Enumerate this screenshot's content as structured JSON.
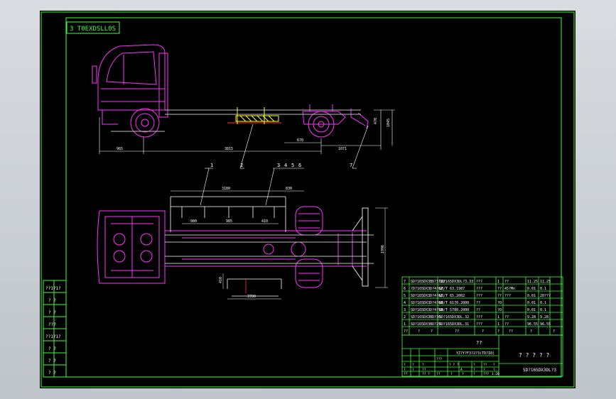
{
  "drawing": {
    "code_box": "3 T0EXDSLL0S",
    "title_main": "? ? ? ? ?",
    "drawing_no": "SD?165DX3DL?3",
    "company": "?? ",
    "sub_code": "YZ?Y?F3?2?3(TD?I0)"
  },
  "callouts": {
    "side": [
      "1",
      "2",
      "7"
    ],
    "plan": [
      "1",
      "3",
      "4",
      "5",
      "6"
    ]
  },
  "dims": {
    "side_front": "965",
    "side_wheelbase": "3815",
    "side_rear1": "670",
    "side_rear2": "1071",
    "side_h1": "470",
    "side_h2": "1045",
    "plan_top": "3180",
    "plan_top2": "830",
    "plan_a": "980",
    "plan_b": "985",
    "plan_c": "410",
    "plan_right": "1996",
    "plan_bottom": "3700",
    "plan_left": "410"
  },
  "left_labels": [
    "??1?1?",
    "? ?",
    "? ?",
    "???",
    "??1?1?",
    "? ?",
    "? ?",
    "? ?"
  ],
  "parts_table": {
    "rows": [
      [
        "7",
        "SD?165DX3BD?3?32",
        "SD?165DX3DL?3.33",
        "???",
        "1",
        "??",
        "11.25",
        "11.25"
      ],
      [
        "6",
        "?D?165DX3D?4?62",
        "GB/T 63.1987",
        "???",
        "??",
        "45?Mn",
        "0.01",
        "0.1"
      ],
      [
        "5",
        "SD?165DX3D?4?61",
        "GB/T 65.2002",
        "???",
        "??",
        "???",
        "0.01",
        "20???"
      ],
      [
        "4",
        "SD?165DX3D?4?60",
        "GB/T 6170.2000",
        "??",
        "?O",
        "",
        "0.01",
        "0.1"
      ],
      [
        "3",
        "SD?165DX3D?4?59",
        "GB/T 5780.2000",
        "??",
        "?O",
        "",
        "0.01",
        "0.1"
      ],
      [
        "2",
        "SD?165DX3BD?30",
        "SD?165DX3DL.32",
        "???",
        "1",
        "??",
        "9.28",
        "9.28"
      ],
      [
        "1",
        "SD?165DX3BD?29",
        "SD?165DX3DL.31",
        "???",
        "1",
        "??",
        "96.55",
        "96.55"
      ]
    ],
    "header": [
      "??",
      "?",
      "?",
      "??",
      "?",
      "?",
      "??",
      "?",
      "?"
    ]
  },
  "title_block": {
    "left_cells": [
      "?",
      "?",
      "?",
      "???",
      "?",
      "?",
      "??",
      "? ? ?",
      "??",
      "?? ?",
      "??",
      "?",
      "?"
    ],
    "right_cells": [
      "A",
      "?",
      "?",
      "?",
      "??",
      "?",
      "?",
      "?",
      "???",
      "1:20"
    ]
  }
}
